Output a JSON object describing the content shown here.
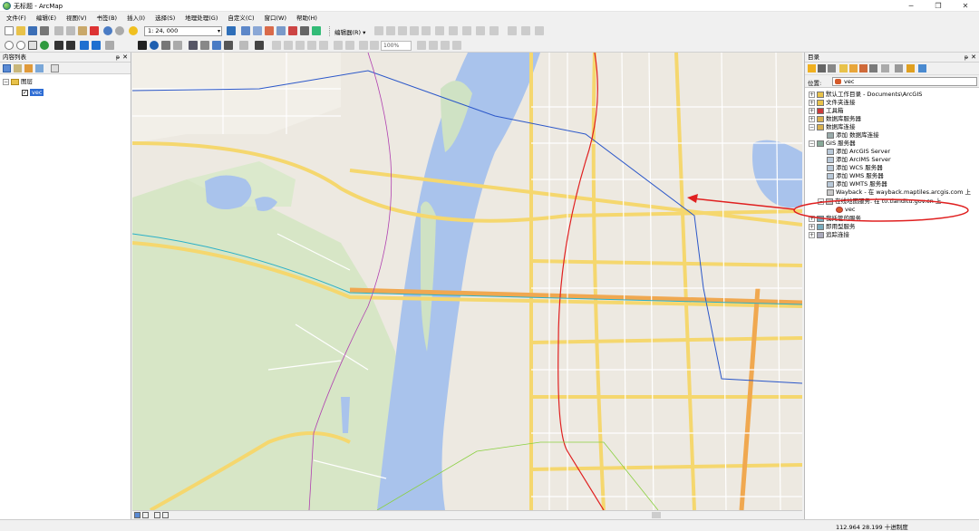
{
  "window": {
    "title": "无标题 - ArcMap",
    "controls": [
      "─",
      "❐",
      "✕"
    ]
  },
  "menu": [
    "文件(F)",
    "编辑(E)",
    "视图(V)",
    "书签(B)",
    "插入(I)",
    "选择(S)",
    "地理处理(G)",
    "自定义(C)",
    "窗口(W)",
    "帮助(H)"
  ],
  "toolbar": {
    "scale_value": "1: 24, 000",
    "editor_label": "编辑器(R) ▾",
    "zoom_value": "100%"
  },
  "toc": {
    "title": "内容列表",
    "pin": "ᵽ",
    "close": "✕",
    "layer_group": "图层",
    "layer": "vec",
    "expander_open": "−",
    "checkbox_mark": "✓"
  },
  "catalog": {
    "title": "目录",
    "pin": "ᵽ",
    "close": "✕",
    "location_label": "位置:",
    "location_value": "vec",
    "expander_closed": "+",
    "expander_open": "−",
    "items": [
      "默认工作目录 - Documents\\ArcGIS",
      "文件夹连接",
      "工具箱",
      "数据库服务器",
      "数据库连接",
      "添加 数据库连接",
      "GIS 服务器",
      "添加 ArcGIS Server",
      "添加 ArcIMS Server",
      "添加 WCS 服务器",
      "添加 WMS 服务器",
      "添加 WMTS 服务器",
      "Wayback - 在 wayback.maptiles.arcgis.com 上",
      "在线地图服务. 在 t0.tianditu.gov.cn 上",
      "vec",
      "我托管的服务",
      "即用型服务",
      "追踪连接"
    ]
  },
  "status": {
    "coordinates": "112.964  28.199 十进制度"
  },
  "colors": {
    "river": "#a9c3ec",
    "road_major": "#f5d76e",
    "land": "#ede9e1",
    "park": "#d6e8c8",
    "annotation": "#e02020",
    "selection": "#2d6cd4"
  },
  "icons": [
    "new-doc-icon",
    "open-icon",
    "save-icon",
    "print-icon",
    "cut-icon",
    "copy-icon",
    "paste-icon",
    "delete-icon",
    "undo-icon",
    "redo-icon",
    "add-data-icon",
    "zoom-in-icon",
    "zoom-out-icon",
    "pan-icon",
    "full-extent-icon",
    "select-icon",
    "identify-icon",
    "back-icon",
    "forward-icon",
    "home-icon",
    "refresh-icon",
    "connect-folder-icon"
  ]
}
